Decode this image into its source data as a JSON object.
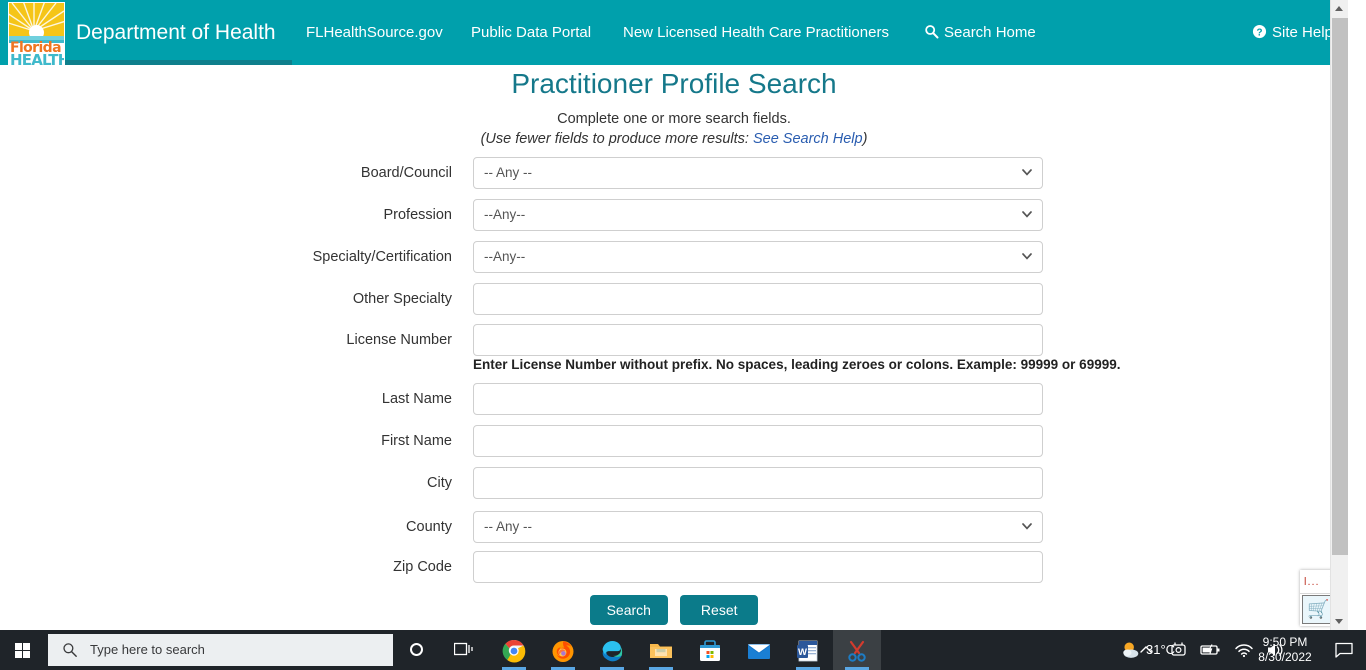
{
  "header": {
    "brand_title": "Department of Health",
    "logo": {
      "line1": "Florida",
      "line2": "HEALTH",
      "icon": "florida-health-sun-logo"
    },
    "nav": [
      {
        "id": "flhealthsource",
        "label": "FLHealthSource.gov"
      },
      {
        "id": "publicdata",
        "label": "Public Data Portal"
      },
      {
        "id": "newlicensed",
        "label": "New Licensed Health Care Practitioners"
      },
      {
        "id": "searchhome",
        "label": "Search Home",
        "icon": "search-icon"
      },
      {
        "id": "sitehelp",
        "label": "Site Help",
        "icon": "question-circle-icon"
      }
    ],
    "bg_color": "#00a0ac",
    "underline_color": "#0e7f8c"
  },
  "main": {
    "title": "Practitioner Profile Search",
    "title_color": "#15788a",
    "subtitle_line1": "Complete one or more search fields.",
    "subtitle_line2_prefix": "(Use fewer fields to produce more results: ",
    "subtitle_link": "See Search Help",
    "subtitle_line2_suffix": ")",
    "link_color": "#2a5db0",
    "fields": [
      {
        "id": "board-council",
        "label": "Board/Council",
        "type": "select",
        "value": "-- Any --"
      },
      {
        "id": "profession",
        "label": "Profession",
        "type": "select",
        "value": "--Any--"
      },
      {
        "id": "specialty-certification",
        "label": "Specialty/Certification",
        "type": "select",
        "value": "--Any--"
      },
      {
        "id": "other-specialty",
        "label": "Other Specialty",
        "type": "text",
        "value": "",
        "placeholder": ""
      },
      {
        "id": "license-number",
        "label": "License Number",
        "type": "text",
        "value": "",
        "placeholder": ""
      },
      {
        "id": "last-name",
        "label": "Last Name",
        "type": "text",
        "value": "",
        "placeholder": ""
      },
      {
        "id": "first-name",
        "label": "First Name",
        "type": "text",
        "value": "",
        "placeholder": ""
      },
      {
        "id": "city",
        "label": "City",
        "type": "text",
        "value": "",
        "placeholder": ""
      },
      {
        "id": "county",
        "label": "County",
        "type": "select",
        "value": "-- Any --"
      },
      {
        "id": "zip-code",
        "label": "Zip Code",
        "type": "text",
        "value": "",
        "placeholder": ""
      }
    ],
    "license_hint": "Enter License Number without prefix. No spaces, leading zeroes or colons. Example: 99999 or 69999.",
    "buttons": {
      "search": "Search",
      "reset": "Reset",
      "color": "#0b7b8a"
    }
  },
  "float_widget": {
    "name": "snip-thumbnail-preview",
    "close_label": "×",
    "bars": "l..."
  },
  "taskbar": {
    "start": "start-button",
    "search_placeholder": "Type here to search",
    "cortana": "cortana-icon",
    "taskview": "task-view-icon",
    "apps": [
      {
        "id": "chrome",
        "name": "google-chrome-icon",
        "running": true,
        "active": false
      },
      {
        "id": "firefox",
        "name": "mozilla-firefox-icon",
        "running": true,
        "active": false
      },
      {
        "id": "edge",
        "name": "microsoft-edge-icon",
        "running": true,
        "active": false
      },
      {
        "id": "explorer",
        "name": "file-explorer-icon",
        "running": true,
        "active": false
      },
      {
        "id": "store",
        "name": "microsoft-store-icon",
        "running": false,
        "active": false
      },
      {
        "id": "mail",
        "name": "mail-icon",
        "running": false,
        "active": false
      },
      {
        "id": "word",
        "name": "microsoft-word-icon",
        "running": true,
        "active": false
      },
      {
        "id": "snip",
        "name": "snipping-tool-icon",
        "running": true,
        "active": true
      }
    ],
    "tray": {
      "weather_temp": "31°C",
      "weather_icon": "partly-cloudy-icon",
      "chevron": "show-hidden-icons-chevron",
      "onedrive": "onedrive-icon",
      "battery": "battery-icon",
      "wifi": "wifi-icon",
      "volume": "volume-icon",
      "time": "9:50 PM",
      "date": "8/30/2022",
      "action_center": "action-center-icon"
    }
  }
}
